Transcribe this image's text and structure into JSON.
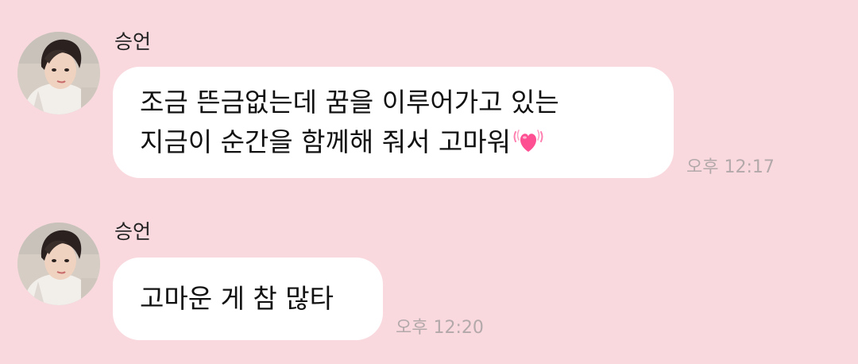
{
  "messages": [
    {
      "sender": "승언",
      "lines": [
        "조금 뜬금없는데 꿈을 이루어가고 있는",
        "지금이 순간을 함께해 줘서 고마워"
      ],
      "emoji": "growing-heart-icon",
      "time": "오후 12:17"
    },
    {
      "sender": "승언",
      "lines": [
        "고마운 게 참 많타"
      ],
      "time": "오후 12:20"
    }
  ],
  "colors": {
    "background": "#f9d9de",
    "bubble": "#ffffff",
    "heart": "#ff4f93"
  }
}
